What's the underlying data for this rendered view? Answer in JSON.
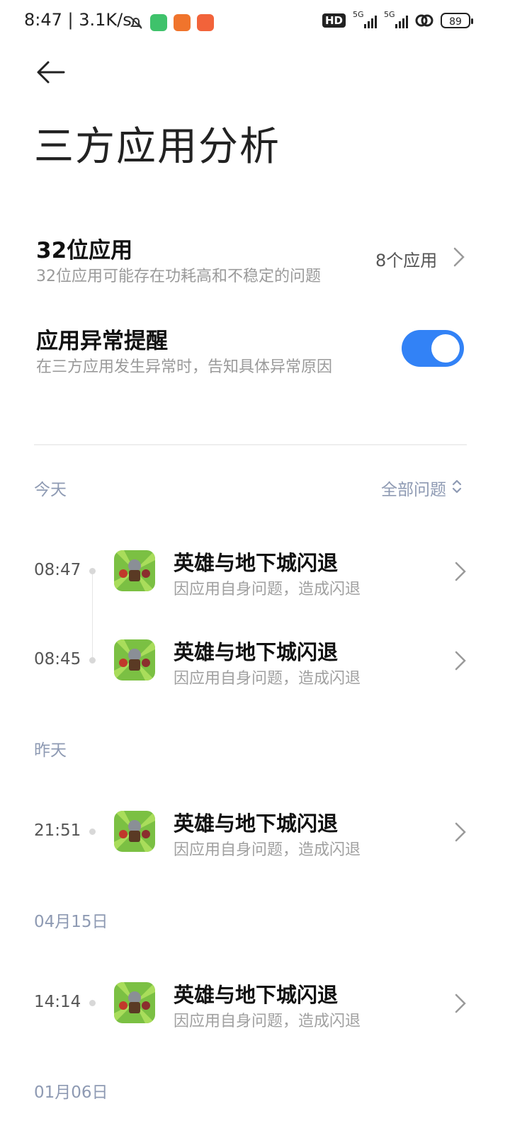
{
  "status_bar": {
    "time": "8:47",
    "net_speed": "3.1K/s",
    "hd_label": "HD",
    "network_1": "5G",
    "network_2": "5G",
    "battery": "89"
  },
  "header": {
    "title": "三方应用分析"
  },
  "settings": {
    "apps32": {
      "title": "32位应用",
      "desc": "32位应用可能存在功耗高和不稳定的问题",
      "value": "8个应用"
    },
    "alert": {
      "title": "应用异常提醒",
      "desc": "在三方应用发生异常时，告知具体异常原因",
      "enabled": true
    }
  },
  "filter": {
    "label": "全部问题"
  },
  "sections": [
    {
      "label": "今天",
      "events": [
        {
          "time": "08:47",
          "app": "英雄与地下城闪退",
          "reason": "因应用自身问题，造成闪退"
        },
        {
          "time": "08:45",
          "app": "英雄与地下城闪退",
          "reason": "因应用自身问题，造成闪退"
        }
      ]
    },
    {
      "label": "昨天",
      "events": [
        {
          "time": "21:51",
          "app": "英雄与地下城闪退",
          "reason": "因应用自身问题，造成闪退"
        }
      ]
    },
    {
      "label": "04月15日",
      "events": [
        {
          "time": "14:14",
          "app": "英雄与地下城闪退",
          "reason": "因应用自身问题，造成闪退"
        }
      ]
    },
    {
      "label": "01月06日",
      "events": []
    }
  ],
  "colors": {
    "accent": "#3282f6",
    "section_text": "#8e9ab3"
  }
}
